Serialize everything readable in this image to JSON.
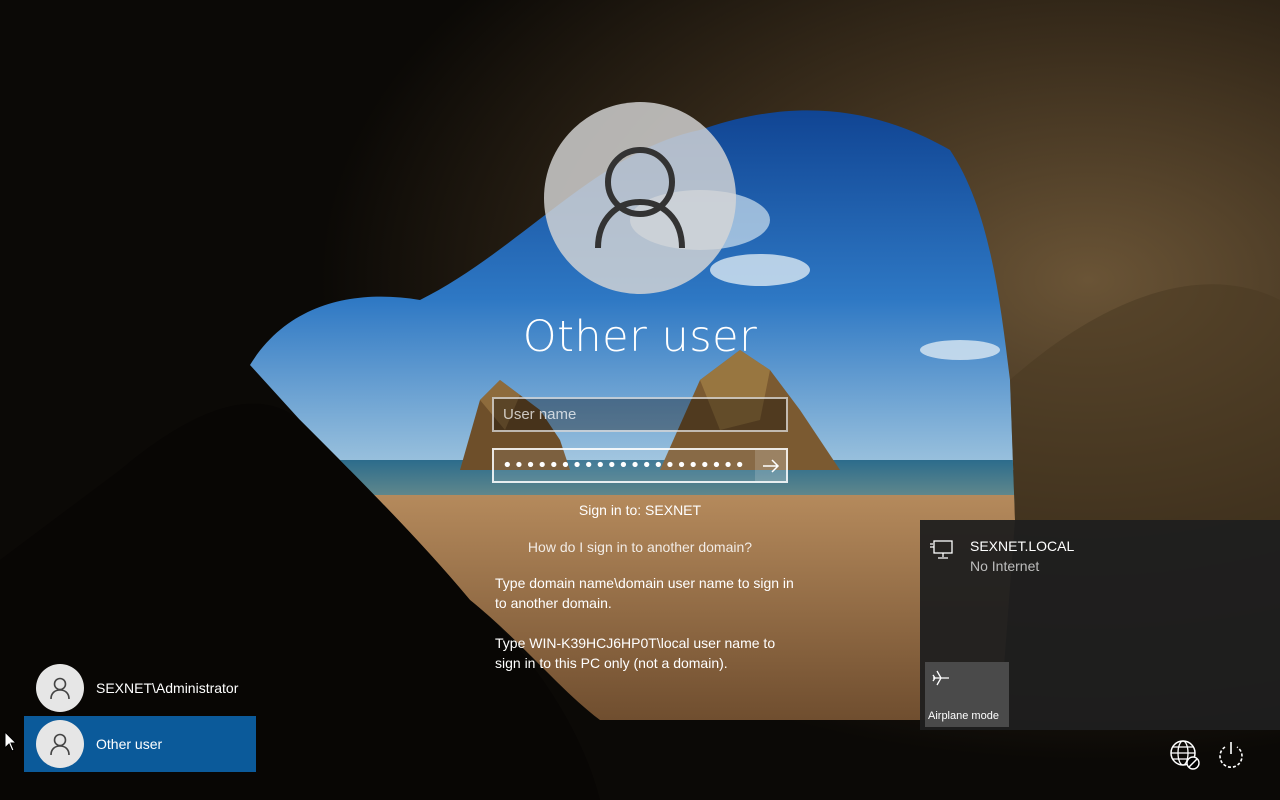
{
  "login": {
    "user_title": "Other user",
    "username_placeholder": "User name",
    "password_value": "••••••••••••••••••••••••••",
    "sign_in_to": "Sign in to: SEXNET",
    "help_link": "How do I sign in to another domain?",
    "help_text_1": "Type domain name\\domain user name to sign in to another domain.",
    "help_text_2": "Type WIN-K39HCJ6HP0T\\local user name to sign in to this PC only (not a domain)."
  },
  "users": [
    {
      "label": "SEXNET\\Administrator",
      "selected": false
    },
    {
      "label": "Other user",
      "selected": true
    }
  ],
  "network_panel": {
    "network_name": "SEXNET.LOCAL",
    "network_status": "No Internet",
    "airplane_label": "Airplane mode"
  },
  "icons": {
    "network": "globe-disconnected-icon",
    "power": "power-icon",
    "submit": "arrow-right-icon",
    "airplane": "airplane-icon",
    "wired": "ethernet-monitor-icon"
  },
  "colors": {
    "selected_user": "#0b5a9a",
    "panel_bg": "#1f1f1f",
    "tile_bg": "#4a4a4a"
  }
}
